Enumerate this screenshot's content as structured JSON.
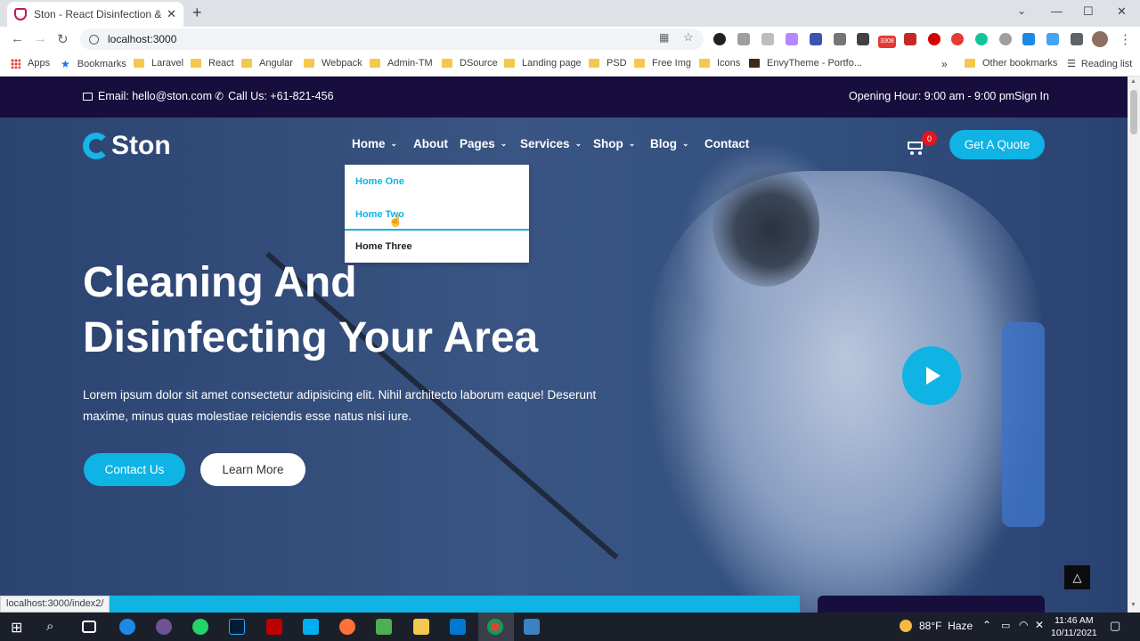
{
  "browser": {
    "tab_title": "Ston - React Disinfection & Sanit",
    "url": "localhost:3000",
    "status_url": "localhost:3000/index2/",
    "extension_badge": "3308",
    "bookmarks": [
      "Apps",
      "Bookmarks",
      "Laravel",
      "React",
      "Angular",
      "Webpack",
      "Admin-TM",
      "DSource",
      "Landing page",
      "PSD",
      "Free Img",
      "Icons",
      "EnvyTheme - Portfo...",
      "Other bookmarks",
      "Reading list"
    ],
    "overflow": "»"
  },
  "site": {
    "topbar": {
      "email": "Email: hello@ston.com",
      "phone": "Call Us: +61-821-456",
      "hours": "Opening Hour: 9:00 am - 9:00 pm",
      "signin": "Sign In"
    },
    "logo_text": "Ston",
    "nav": [
      "Home",
      "About",
      "Pages",
      "Services",
      "Shop",
      "Blog",
      "Contact"
    ],
    "cart_count": "0",
    "quote_button": "Get A Quote",
    "dropdown": [
      "Home One",
      "Home Two",
      "Home Three"
    ],
    "hero": {
      "line1": "Cleaning And",
      "line2": "Disinfecting Your Area",
      "paragraph": "Lorem ipsum dolor sit amet consectetur adipisicing elit. Nihil architecto laborum eaque! Deserunt maxime, minus quas molestiae reiciendis esse natus nisi iure.",
      "contact_button": "Contact Us",
      "learn_button": "Learn More"
    }
  },
  "taskbar": {
    "temperature": "88°F",
    "condition": "Haze",
    "time": "11:46 AM",
    "date": "10/11/2021"
  },
  "colors": {
    "topbar": "#170e3d",
    "accent": "#0fb3e4",
    "badge": "#e4151f"
  }
}
